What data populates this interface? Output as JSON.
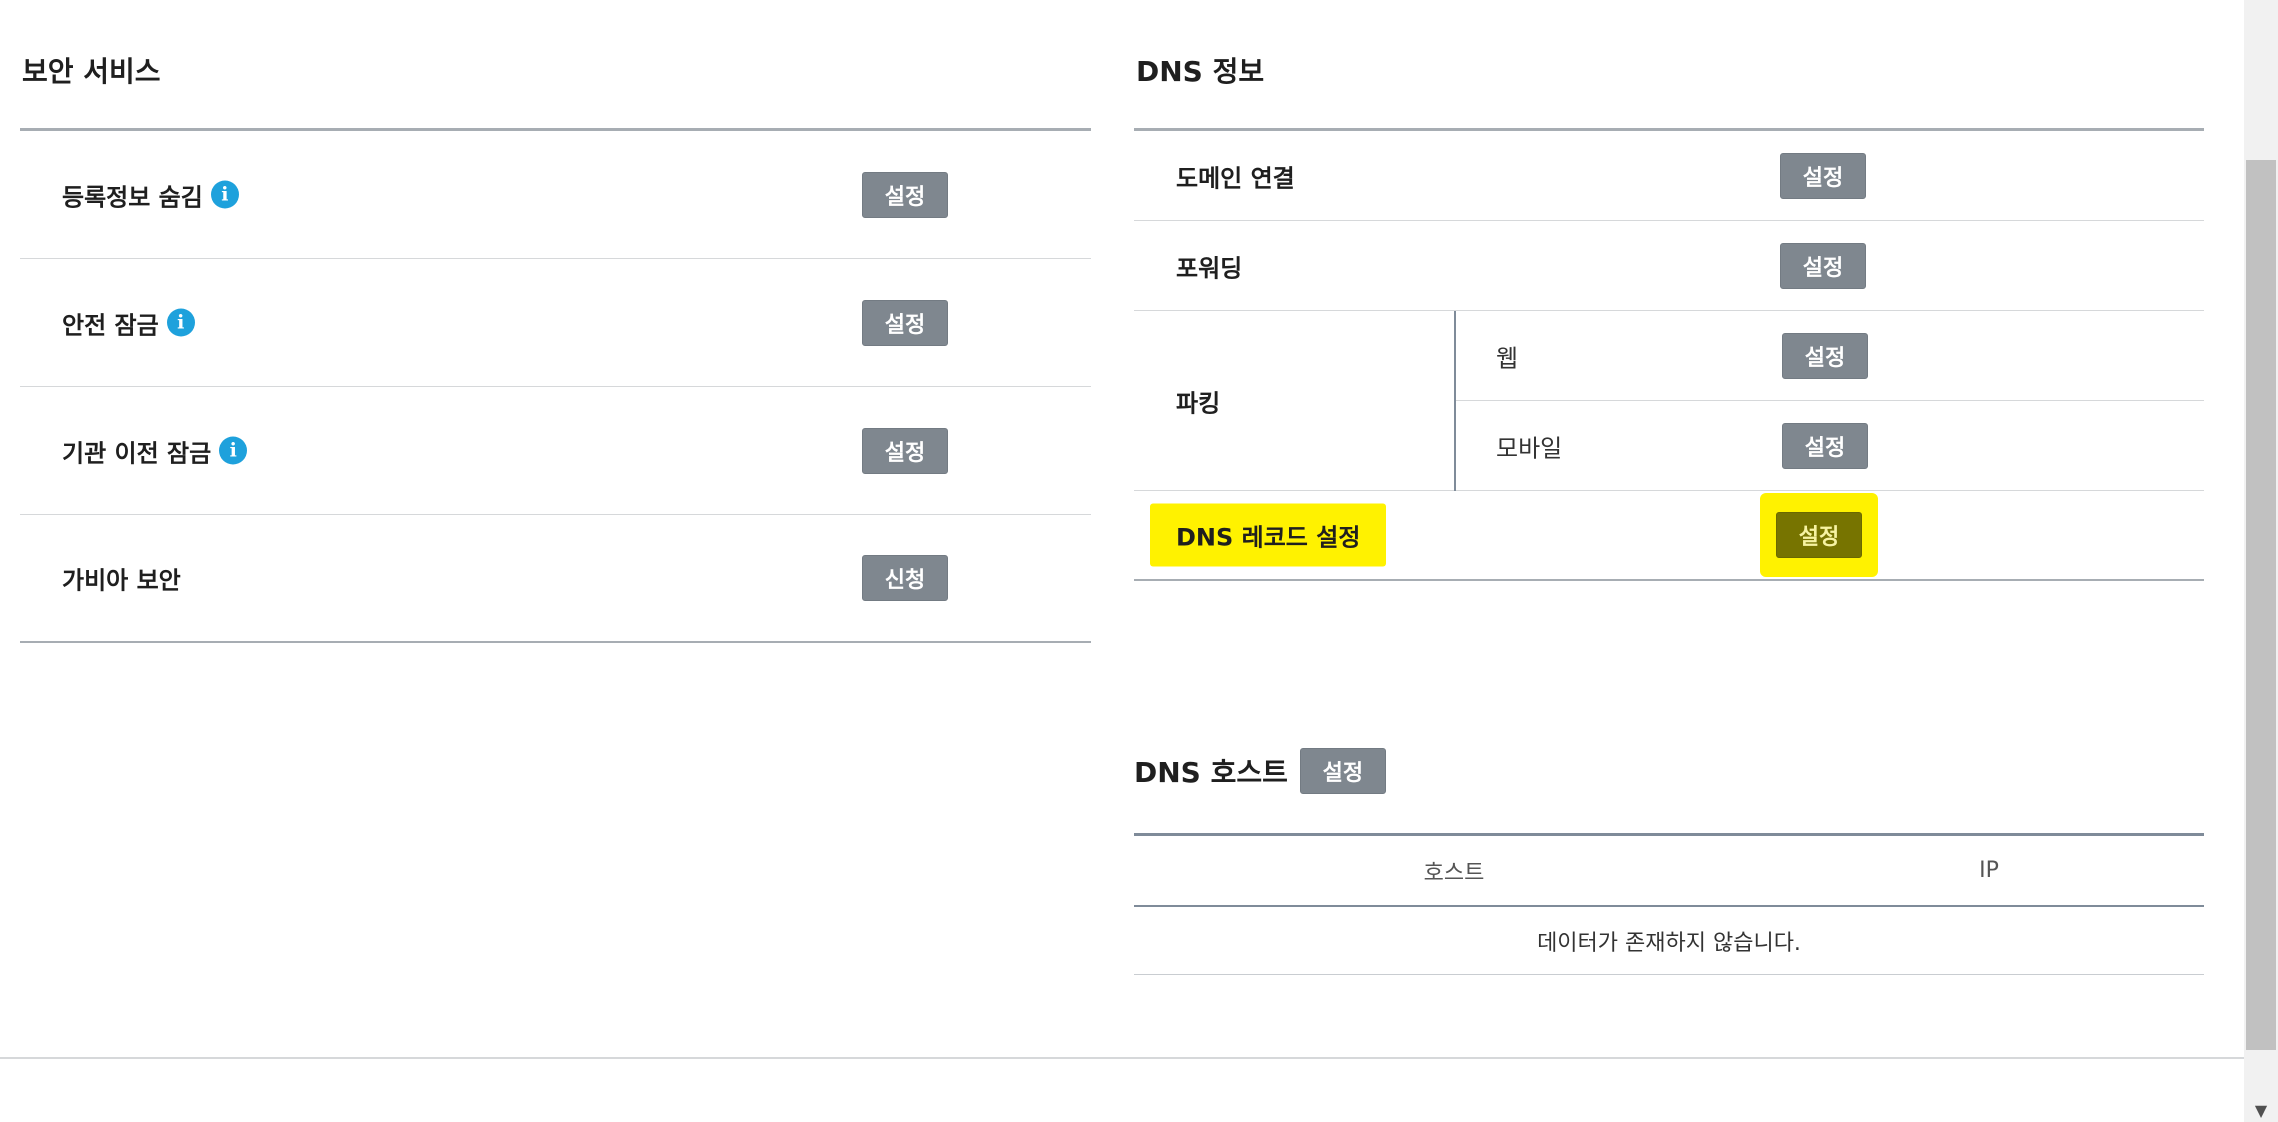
{
  "security": {
    "title": "보안 서비스",
    "rows": [
      {
        "label": "등록정보 숨김",
        "has_info": true,
        "button": "설정"
      },
      {
        "label": "안전 잠금",
        "has_info": true,
        "button": "설정"
      },
      {
        "label": "기관 이전 잠금",
        "has_info": true,
        "button": "설정"
      },
      {
        "label": "가비아 보안",
        "has_info": false,
        "button": "신청"
      }
    ],
    "info_glyph": "i"
  },
  "dns_info": {
    "title": "DNS 정보",
    "domain_connect": {
      "label": "도메인 연결",
      "button": "설정"
    },
    "forwarding": {
      "label": "포워딩",
      "button": "설정"
    },
    "parking": {
      "label": "파킹",
      "web": {
        "label": "웹",
        "button": "설정"
      },
      "mobile": {
        "label": "모바일",
        "button": "설정"
      }
    },
    "dns_record": {
      "label": "DNS 레코드 설정",
      "button": "설정"
    }
  },
  "dns_host": {
    "title": "DNS 호스트",
    "button": "설정",
    "columns": [
      "호스트",
      "IP"
    ],
    "empty_message": "데이터가 존재하지 않습니다."
  },
  "scrollbar": {
    "down_arrow": "▼"
  },
  "colors": {
    "button_bg": "#7f878f",
    "highlight": "#fff200",
    "info_icon": "#1ea1dc"
  }
}
